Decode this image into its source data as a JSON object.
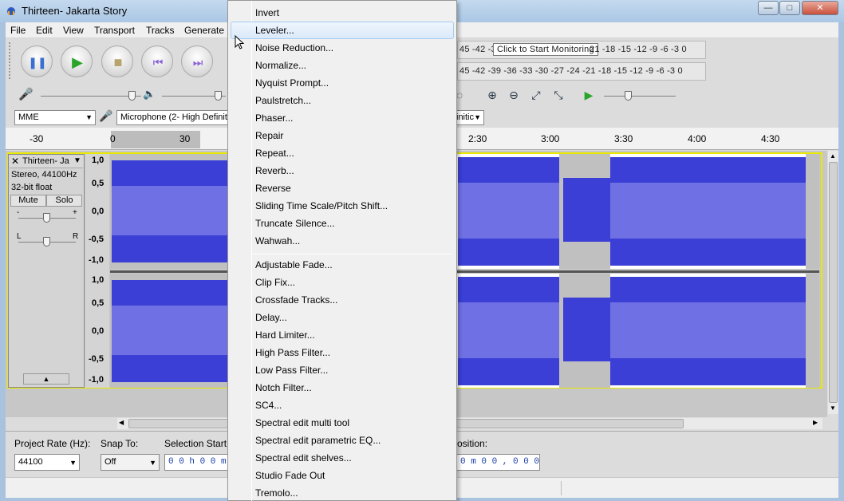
{
  "window": {
    "title": "Thirteen- Jakarta Story",
    "minimize": "—",
    "maximize": "□",
    "close": "✕"
  },
  "menubar": {
    "items": [
      "File",
      "Edit",
      "View",
      "Transport",
      "Tracks",
      "Generate"
    ]
  },
  "meters": {
    "record_scale": "45  -42  -3",
    "record_tooltip": "Click to Start Monitoring",
    "record_scale_right": "21  -18  -15  -12   -9   -6   -3   0",
    "play_scale": "45  -42  -39  -36  -33  -30  -27  -24  -21  -18  -15  -12   -9   -6   -3   0"
  },
  "device": {
    "host": "MME",
    "mic_input": "Microphone (2- High Definitio",
    "channels_partial": "initic"
  },
  "ruler": {
    "labels_left": [
      "-30",
      "0",
      "30"
    ],
    "labels_right": [
      "2:30",
      "3:00",
      "3:30",
      "4:00",
      "4:30"
    ]
  },
  "track": {
    "name": "Thirteen- Ja",
    "format": "Stereo, 44100Hz",
    "bit_depth": "32-bit float",
    "mute": "Mute",
    "solo": "Solo",
    "gain_minus": "-",
    "gain_plus": "+",
    "pan_left": "L",
    "pan_right": "R",
    "scale": [
      "1,0",
      "0,5",
      "0,0",
      "-0,5",
      "-1,0"
    ]
  },
  "selection_toolbar": {
    "project_rate_label": "Project Rate (Hz):",
    "project_rate_value": "44100",
    "snap_to_label": "Snap To:",
    "snap_to_value": "Off",
    "selection_start_label": "Selection Start",
    "selection_start_value": "0 0 h 0 0 m",
    "position_label": "osition:",
    "position_value": "0 m 0 0 , 0 0 0  s"
  },
  "effect_menu": {
    "items_group1": [
      "Invert",
      "Leveler...",
      "Noise Reduction...",
      "Normalize...",
      "Nyquist Prompt...",
      "Paulstretch...",
      "Phaser...",
      "Repair",
      "Repeat...",
      "Reverb...",
      "Reverse",
      "Sliding Time Scale/Pitch Shift...",
      "Truncate Silence...",
      "Wahwah..."
    ],
    "items_group2": [
      "Adjustable Fade...",
      "Clip Fix...",
      "Crossfade Tracks...",
      "Delay...",
      "Hard Limiter...",
      "High Pass Filter...",
      "Low Pass Filter...",
      "Notch Filter...",
      "SC4...",
      "Spectral edit multi tool",
      "Spectral edit parametric EQ...",
      "Spectral edit shelves...",
      "Studio Fade Out",
      "Tremolo..."
    ],
    "highlighted": "Leveler..."
  },
  "colors": {
    "waveform": "#3b3fd6",
    "waveform_rms": "#6e70e4",
    "selection": "#c0c0c0",
    "menu_highlight": "#dbe9f9"
  }
}
